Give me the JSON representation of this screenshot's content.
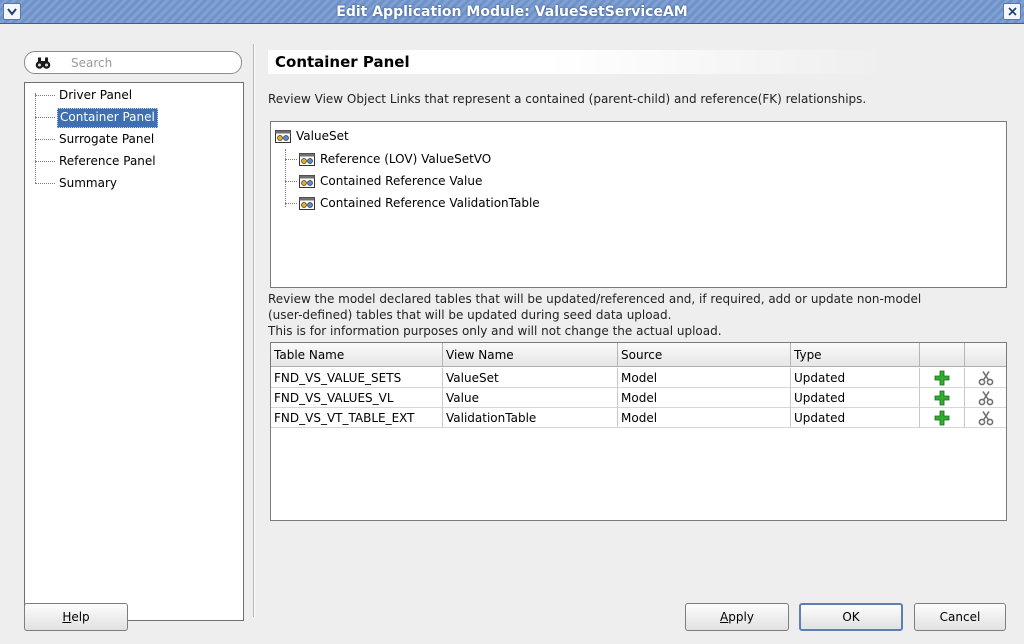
{
  "window": {
    "title": "Edit Application Module: ValueSetServiceAM"
  },
  "search": {
    "placeholder": "Search"
  },
  "nav": {
    "items": [
      {
        "label": "Driver Panel",
        "selected": false
      },
      {
        "label": "Container Panel",
        "selected": true
      },
      {
        "label": "Surrogate Panel",
        "selected": false
      },
      {
        "label": "Reference Panel",
        "selected": false
      },
      {
        "label": "Summary",
        "selected": false
      }
    ]
  },
  "panel": {
    "title": "Container Panel",
    "description": "Review View Object Links that represent a contained (parent-child) and reference(FK) relationships."
  },
  "tree": {
    "root": "ValueSet",
    "children": [
      "Reference (LOV) ValueSetVO",
      "Contained Reference Value",
      "Contained Reference ValidationTable"
    ]
  },
  "info": {
    "line1": "Review the model declared tables that will be updated/referenced and, if required, add or update non-model",
    "line2": "(user-defined) tables that will be updated during seed data upload.",
    "line3": "This is for information purposes only and will not change the actual upload."
  },
  "table": {
    "columns": [
      "Table Name",
      "View Name",
      "Source",
      "Type",
      "",
      ""
    ],
    "rows": [
      {
        "table_name": "FND_VS_VALUE_SETS",
        "view_name": "ValueSet",
        "source": "Model",
        "type": "Updated",
        "add_icon": "add-icon",
        "delete_icon": "scissors-icon"
      },
      {
        "table_name": "FND_VS_VALUES_VL",
        "view_name": "Value",
        "source": "Model",
        "type": "Updated",
        "add_icon": "add-icon",
        "delete_icon": "scissors-icon"
      },
      {
        "table_name": "FND_VS_VT_TABLE_EXT",
        "view_name": "ValidationTable",
        "source": "Model",
        "type": "Updated",
        "add_icon": "add-icon",
        "delete_icon": "scissors-icon"
      }
    ]
  },
  "buttons": {
    "help": {
      "mnemonic": "H",
      "rest": "elp"
    },
    "apply": {
      "mnemonic": "A",
      "rest": "pply"
    },
    "ok": "OK",
    "cancel": "Cancel"
  },
  "colors": {
    "title_bar": "#7fa1d4",
    "selection": "#3d6fb2",
    "add_icon": "#2fae2f"
  }
}
